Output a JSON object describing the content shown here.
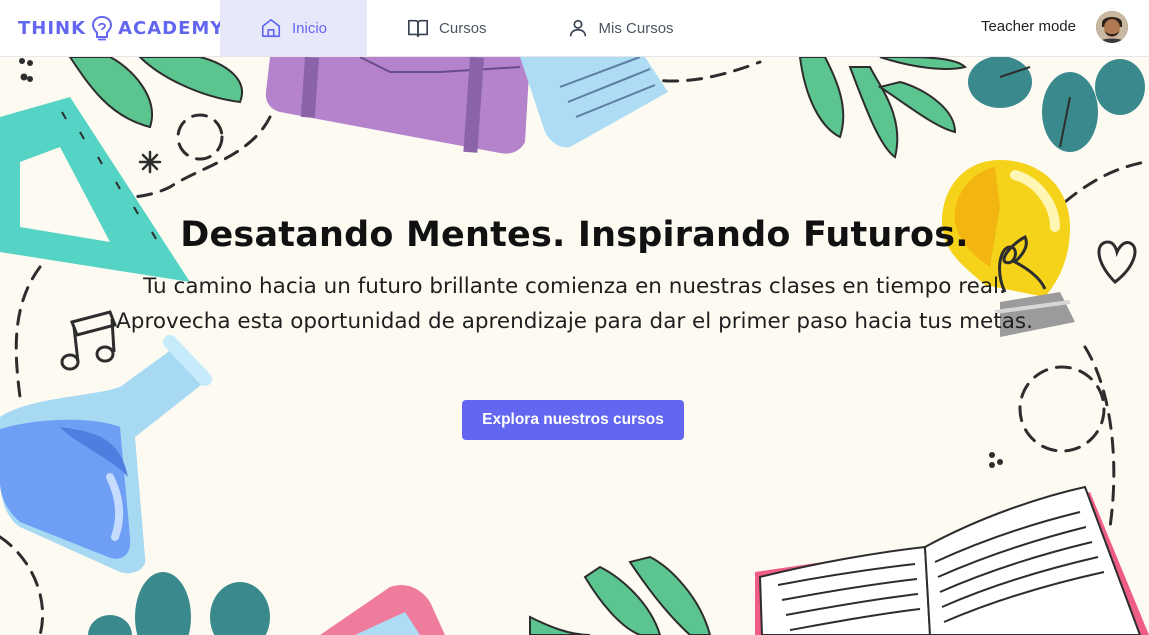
{
  "brand": {
    "logo_left": "THINK",
    "logo_right": "ACADEMY",
    "color": "#6366f1"
  },
  "nav": {
    "tabs": [
      {
        "label": "Inicio",
        "icon": "home-icon",
        "active": true
      },
      {
        "label": "Cursos",
        "icon": "book-icon",
        "active": false
      },
      {
        "label": "Mis Cursos",
        "icon": "user-icon",
        "active": false
      }
    ],
    "teacher_mode": "Teacher mode"
  },
  "hero": {
    "headline": "Desatando Mentes. Inspirando Futuros.",
    "subtitle_line1": "Tu camino hacia un futuro brillante comienza en nuestras clases en tiempo real.",
    "subtitle_line2": "Aprovecha esta oportunidad de aprendizaje para dar el primer paso hacia tus metas.",
    "cta_label": "Explora nuestros cursos",
    "background_color": "#fdfaf2",
    "cta_color": "#6366f1"
  }
}
